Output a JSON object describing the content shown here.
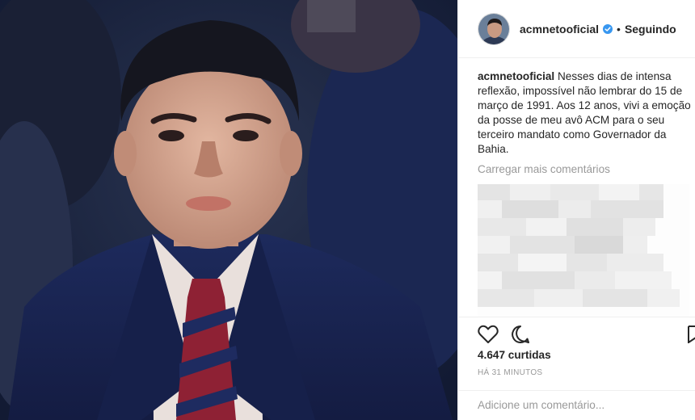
{
  "post": {
    "username": "acmnetooficial",
    "follow_separator": "•",
    "follow_status": "Seguindo",
    "caption_username": "acmnetooficial",
    "caption_text": "Nesses dias de intensa reflexão, impossível não lembrar do 15 de março de 1991. Aos 12 anos, vivi a emoção da posse de meu avô ACM para o seu terceiro mandato como Governador da Bahia.",
    "load_more": "Carregar mais comentários",
    "likes": "4.647 curtidas",
    "timestamp": "HÁ 31 MINUTOS",
    "comment_placeholder": "Adicione um comentário..."
  },
  "icons": {
    "like": "heart-icon",
    "comment": "comment-bubble-icon",
    "save": "bookmark-icon",
    "verified": "verified-badge-icon"
  },
  "colors": {
    "verified": "#3897f0",
    "muted": "#999999",
    "text": "#262626"
  }
}
